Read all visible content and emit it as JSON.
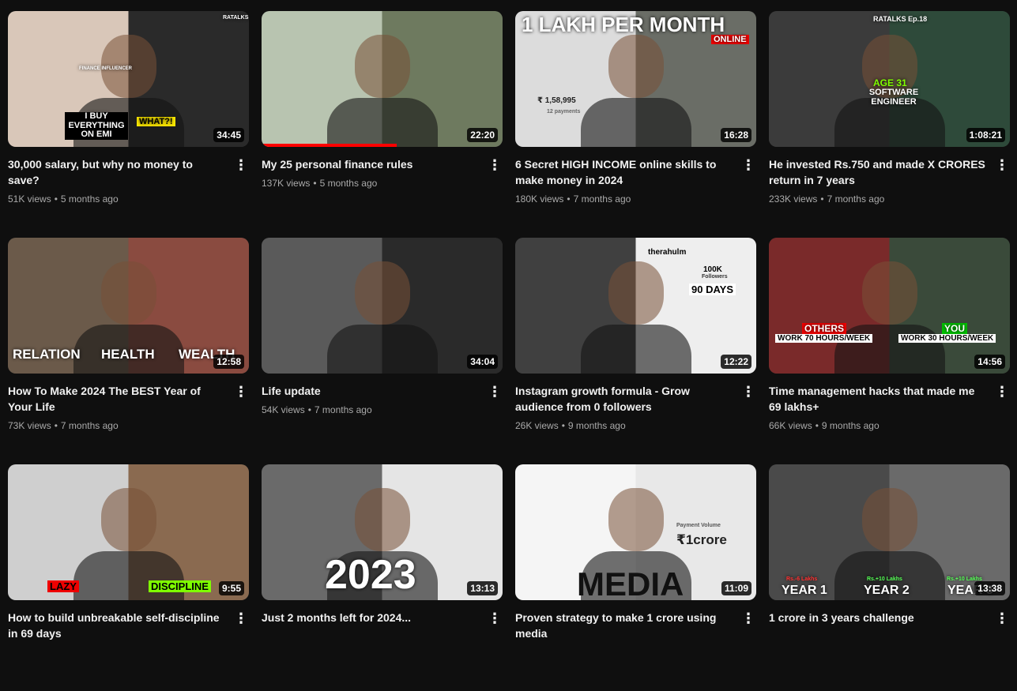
{
  "videos": [
    {
      "title": "30,000 salary, but why no money to save?",
      "views": "51K views",
      "age": "5 months ago",
      "duration": "34:45",
      "overlay": [
        "I BUY EVERYTHING ON EMI",
        "WHAT?!",
        "RATALKS Ep.19",
        "FINANCE INFLUENCER"
      ],
      "colors": [
        "#d9c7b9",
        "#2a2a2a"
      ]
    },
    {
      "title": "My 25 personal finance rules",
      "views": "137K views",
      "age": "5 months ago",
      "duration": "22:20",
      "progress": 0.56,
      "overlay": [],
      "colors": [
        "#b8c4b0",
        "#6e7a5f"
      ]
    },
    {
      "title": "6 Secret HIGH INCOME online skills to make money in 2024",
      "views": "180K views",
      "age": "7 months ago",
      "duration": "16:28",
      "overlay": [
        "1 LAKH PER MONTH",
        "ONLINE",
        "₹ 1,58,995",
        "12 payments"
      ],
      "colors": [
        "#dcdcdc",
        "#6a6d66"
      ]
    },
    {
      "title": "He invested Rs.750 and made X CRORES return in 7 years",
      "views": "233K views",
      "age": "7 months ago",
      "duration": "1:08:21",
      "overlay": [
        "RATALKS Ep.18",
        "AGE 31",
        "SOFTWARE ENGINEER"
      ],
      "colors": [
        "#3b3b3b",
        "#2e4a3a"
      ]
    },
    {
      "title": "How To Make 2024 The BEST Year of Your Life",
      "views": "73K views",
      "age": "7 months ago",
      "duration": "12:58",
      "overlay": [
        "RELATION",
        "HEALTH",
        "WEALTH"
      ],
      "colors": [
        "#6b5a4a",
        "#8a4b40"
      ]
    },
    {
      "title": "Life update",
      "views": "54K views",
      "age": "7 months ago",
      "duration": "34:04",
      "overlay": [],
      "colors": [
        "#5a5a5a",
        "#2a2a2a"
      ]
    },
    {
      "title": "Instagram growth formula - Grow audience from 0 followers",
      "views": "26K views",
      "age": "9 months ago",
      "duration": "12:22",
      "overlay": [
        "therahulm",
        "100K",
        "Followers",
        "90 DAYS"
      ],
      "colors": [
        "#404040",
        "#eeeeee"
      ]
    },
    {
      "title": "Time management hacks that made me 69 lakhs+",
      "views": "66K views",
      "age": "9 months ago",
      "duration": "14:56",
      "overlay": [
        "OTHERS",
        "WORK 70 HOURS/WEEK",
        "YOU",
        "WORK 30 HOURS/WEEK"
      ],
      "colors": [
        "#7a2a2a",
        "#3a4a3a"
      ]
    },
    {
      "title": "How to build unbreakable self-discipline in 69 days",
      "views": "",
      "age": "",
      "duration": "9:55",
      "overlay": [
        "LAZY",
        "DISCIPLINE"
      ],
      "colors": [
        "#cfcfcf",
        "#8a6a50"
      ]
    },
    {
      "title": "Just 2 months left for 2024...",
      "views": "",
      "age": "",
      "duration": "13:13",
      "overlay": [
        "2023"
      ],
      "colors": [
        "#6a6a6a",
        "#e5e5e5"
      ]
    },
    {
      "title": "Proven strategy to make 1 crore using media",
      "views": "",
      "age": "",
      "duration": "11:09",
      "overlay": [
        "MEDIA",
        "Payment Volume",
        "₹1crore"
      ],
      "colors": [
        "#f5f5f5",
        "#e8e8e8"
      ]
    },
    {
      "title": "1 crore in 3 years challenge",
      "views": "",
      "age": "",
      "duration": "13:38",
      "overlay": [
        "Rs.-6 Lakhs",
        "YEAR 1",
        "Rs.+10 Lakhs",
        "YEAR 2",
        "Rs.+10 Lakhs",
        "YEAR 3"
      ],
      "colors": [
        "#4a4a4a",
        "#6a6a6a"
      ]
    }
  ]
}
